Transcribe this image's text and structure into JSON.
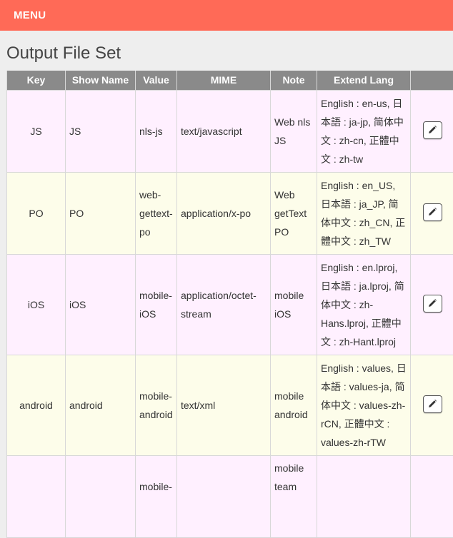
{
  "topbar": {
    "menu_label": "MENU"
  },
  "page": {
    "title": "Output File Set"
  },
  "table": {
    "headers": [
      "Key",
      "Show Name",
      "Value",
      "MIME",
      "Note",
      "Extend Lang",
      ""
    ],
    "rows": [
      {
        "key": "JS",
        "show_name": "JS",
        "value": "nls-js",
        "mime": "text/javascript",
        "note": "Web nls JS",
        "extend_lang": "English : en-us, 日本語 : ja-jp, 简体中文 : zh-cn, 正體中文 : zh-tw"
      },
      {
        "key": "PO",
        "show_name": "PO",
        "value": "web-gettext-po",
        "mime": "application/x-po",
        "note": "Web getText PO",
        "extend_lang": "English : en_US, 日本語 : ja_JP, 简体中文 : zh_CN, 正體中文 : zh_TW"
      },
      {
        "key": "iOS",
        "show_name": "iOS",
        "value": "mobile-iOS",
        "mime": "application/octet-stream",
        "note": "mobile iOS",
        "extend_lang": "English : en.lproj, 日本語 : ja.lproj, 简体中文 : zh-Hans.lproj, 正體中文 : zh-Hant.lproj"
      },
      {
        "key": "android",
        "show_name": "android",
        "value": "mobile-android",
        "mime": "text/xml",
        "note": "mobile android",
        "extend_lang": "English : values, 日本語 : values-ja, 简体中文 : values-zh-rCN, 正體中文 : values-zh-rTW"
      },
      {
        "key": "",
        "show_name": "",
        "value": "mobile-",
        "mime": "",
        "note": "mobile team",
        "extend_lang": ""
      }
    ]
  },
  "icons": {
    "edit": "pencil-icon"
  }
}
